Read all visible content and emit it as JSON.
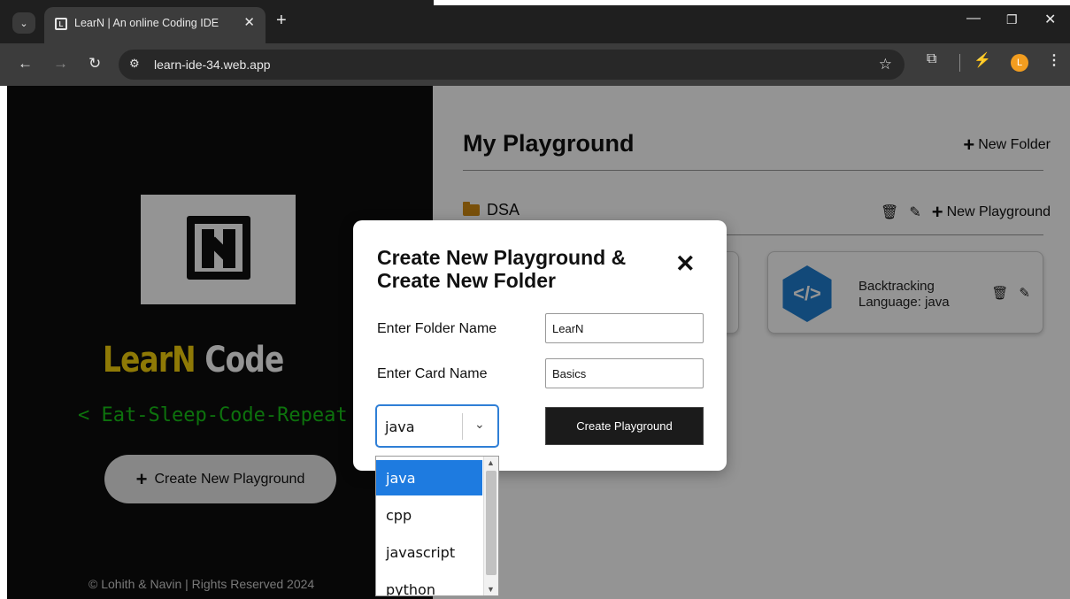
{
  "browser": {
    "tab_title": "LearN | An online Coding IDE",
    "url": "learn-ide-34.web.app",
    "profile_initial": "L",
    "new_tab_symbol": "+",
    "tab_close_symbol": "✕"
  },
  "left_panel": {
    "brand_learn": "Lear",
    "brand_n": "N",
    "brand_code": "Code",
    "tagline": "< Eat-Sleep-Code-Repeat />",
    "create_button": "Create New Playground",
    "footer": "© Lohith & Navin | Rights Reserved 2024"
  },
  "main": {
    "title": "My Playground",
    "new_folder": "New Folder",
    "folder": {
      "name": "DSA",
      "new_playground": "New Playground"
    },
    "cards": [
      {
        "title": "Backtracking",
        "language": "Language: java",
        "icon_glyph": "</>"
      }
    ]
  },
  "modal": {
    "title": "Create New Playground & Create New Folder",
    "folder_label": "Enter Folder Name",
    "folder_value": "LearN",
    "card_label": "Enter Card Name",
    "card_value": "Basics",
    "language_selected": "java",
    "create_button": "Create Playground"
  },
  "dropdown": {
    "options": [
      "java",
      "cpp",
      "javascript",
      "python"
    ],
    "selected_index": 0
  },
  "colors": {
    "accent_blue": "#1e7be0",
    "brand_yellow": "#f5d10c",
    "tagline_green": "#17c417",
    "folder_orange": "#d18a12"
  }
}
